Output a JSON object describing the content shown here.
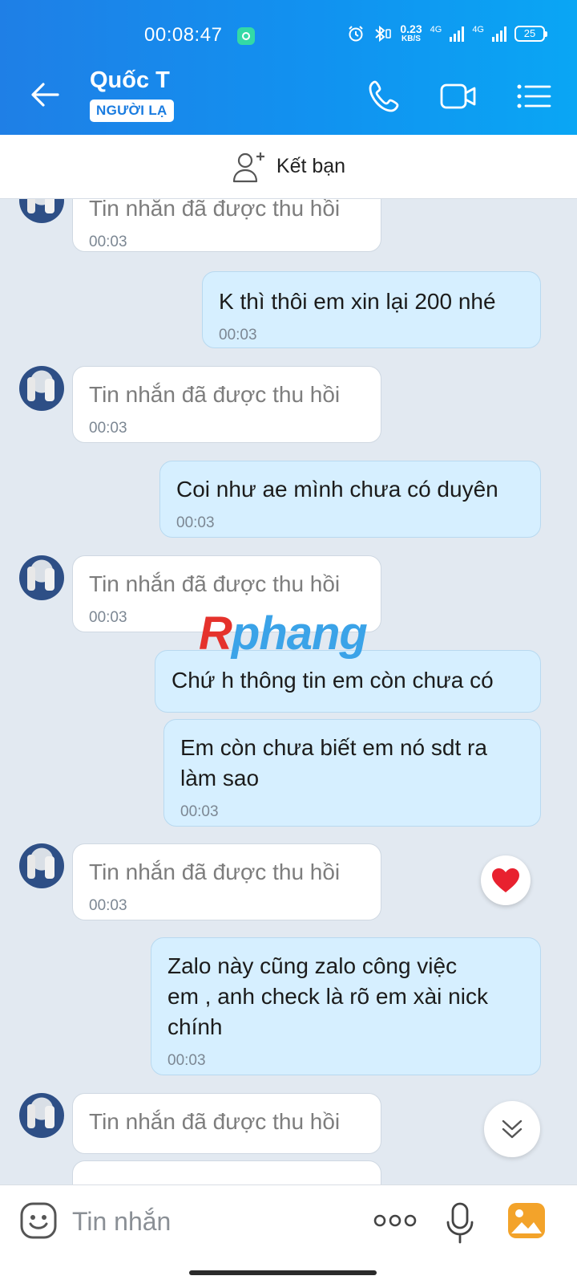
{
  "status_bar": {
    "time": "00:08:47",
    "net_speed_value": "0.23",
    "net_speed_unit": "KB/S",
    "network_1": "4G",
    "network_2": "4G",
    "battery": "25"
  },
  "header": {
    "contact_name": "Quốc T",
    "badge": "NGƯỜI LẠ"
  },
  "friend_bar": {
    "label": "Kết bạn"
  },
  "messages": [
    {
      "direction": "in",
      "text": "Tin nhắn đã được thu hồi",
      "time": "00:03"
    },
    {
      "direction": "out",
      "text": "K thì thôi em xin lại 200 nhé",
      "time": "00:03"
    },
    {
      "direction": "in",
      "text": "Tin nhắn đã được thu hồi",
      "time": "00:03"
    },
    {
      "direction": "out",
      "text": "Coi như ae mình chưa có duyên",
      "time": "00:03"
    },
    {
      "direction": "in",
      "text": "Tin nhắn đã được thu hồi",
      "time": "00:03"
    },
    {
      "direction": "out",
      "text": "Chứ h thông tin em còn chưa có",
      "time": ""
    },
    {
      "direction": "out",
      "text": "Em còn chưa biết em nó sdt ra\nlàm sao",
      "time": "00:03"
    },
    {
      "direction": "in",
      "text": "Tin nhắn đã được thu hồi",
      "time": "00:03"
    },
    {
      "direction": "out",
      "text": "Zalo này cũng zalo công việc\nem , anh check là rõ em xài nick\nchính",
      "time": "00:03"
    },
    {
      "direction": "in",
      "text": "Tin nhắn đã được thu hồi",
      "time": ""
    }
  ],
  "watermark": {
    "first_letter": "R",
    "rest": "phang"
  },
  "input": {
    "placeholder": "Tin nhắn"
  },
  "colors": {
    "header_gradient_start": "#1f7fe6",
    "header_gradient_end": "#0aa6f4",
    "outgoing_bubble": "#d6efff",
    "incoming_bubble": "#ffffff",
    "chat_background": "#e2e9f1"
  }
}
